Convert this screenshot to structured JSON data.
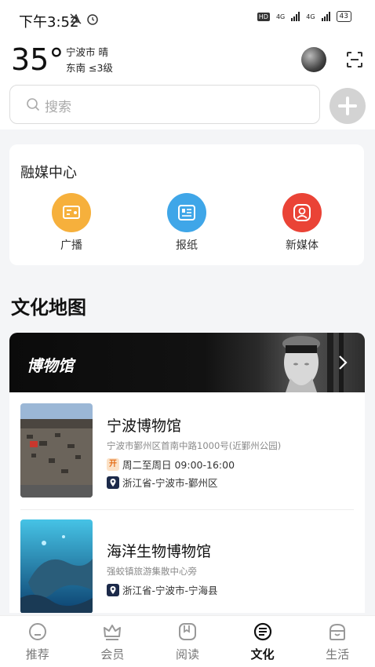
{
  "status": {
    "time": "下午3:52",
    "hd": "HD",
    "net1": "4G",
    "net2": "4G",
    "battery": "43"
  },
  "header": {
    "temperature": "35°",
    "city_weather": "宁波市 晴",
    "wind": "东南 ≤3级"
  },
  "search": {
    "placeholder": "搜索"
  },
  "media_center": {
    "title": "融媒中心",
    "items": [
      {
        "label": "广播",
        "icon": "radio-icon",
        "color": "#f6b03c"
      },
      {
        "label": "报纸",
        "icon": "newspaper-icon",
        "color": "#3fa6e8"
      },
      {
        "label": "新媒体",
        "icon": "new-media-icon",
        "color": "#ea4336"
      }
    ]
  },
  "culture_map": {
    "title": "文化地图",
    "banner_title": "博物馆",
    "museums": [
      {
        "name": "宁波博物馆",
        "address": "宁波市鄞州区首南中路1000号(近鄞州公园)",
        "open_badge": "开",
        "hours": "周二至周日 09:00-16:00",
        "region": "浙江省-宁波市-鄞州区"
      },
      {
        "name": "海洋生物博物馆",
        "address": "强蛟镇旅游集散中心旁",
        "region": "浙江省-宁波市-宁海县"
      }
    ]
  },
  "tabs": [
    {
      "label": "推荐",
      "icon": "recommend-icon"
    },
    {
      "label": "会员",
      "icon": "crown-icon"
    },
    {
      "label": "阅读",
      "icon": "reading-icon"
    },
    {
      "label": "文化",
      "icon": "culture-icon",
      "active": true
    },
    {
      "label": "生活",
      "icon": "life-icon"
    }
  ]
}
